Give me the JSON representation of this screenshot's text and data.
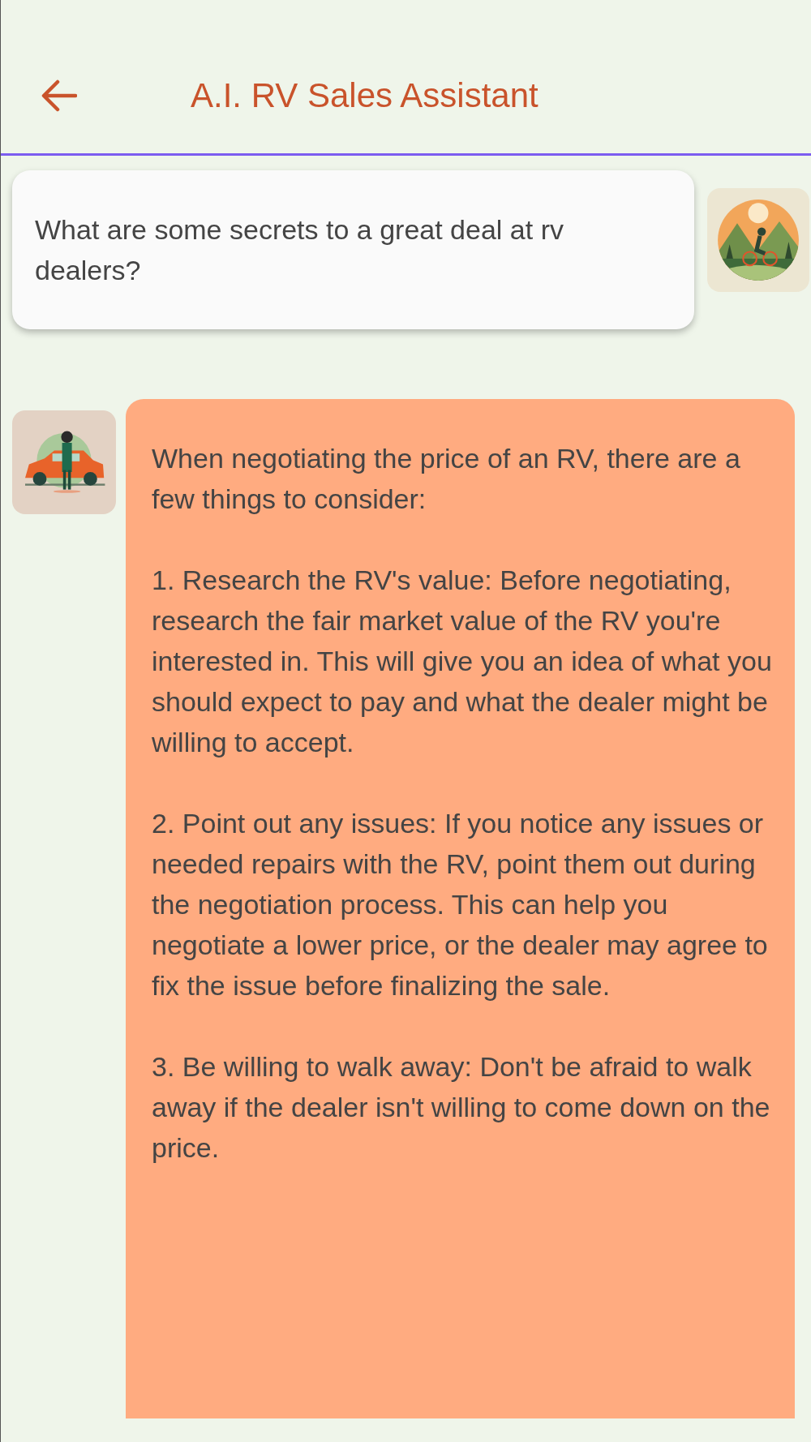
{
  "app_bar": {
    "title": "A.I. RV Sales Assistant"
  },
  "messages": [
    {
      "kind": "user",
      "paragraphs": [
        "What are some secrets to a great deal at rv dealers?"
      ]
    },
    {
      "kind": "assistant",
      "paragraphs": [
        "When negotiating the price of an RV, there are a few things to consider:",
        "1. Research the RV's value: Before negotiating, research the fair market value of the RV you're interested in. This will give you an idea of what you should expect to pay and what the dealer might be willing to accept.",
        "2. Point out any issues: If you notice any issues or needed repairs with the RV, point them out during the negotiation process. This can help you negotiate a lower price, or the dealer may agree to fix the issue before finalizing the sale.",
        "3. Be willing to walk away: Don't be afraid to walk away if the dealer isn't willing to come down on the price."
      ]
    }
  ]
}
